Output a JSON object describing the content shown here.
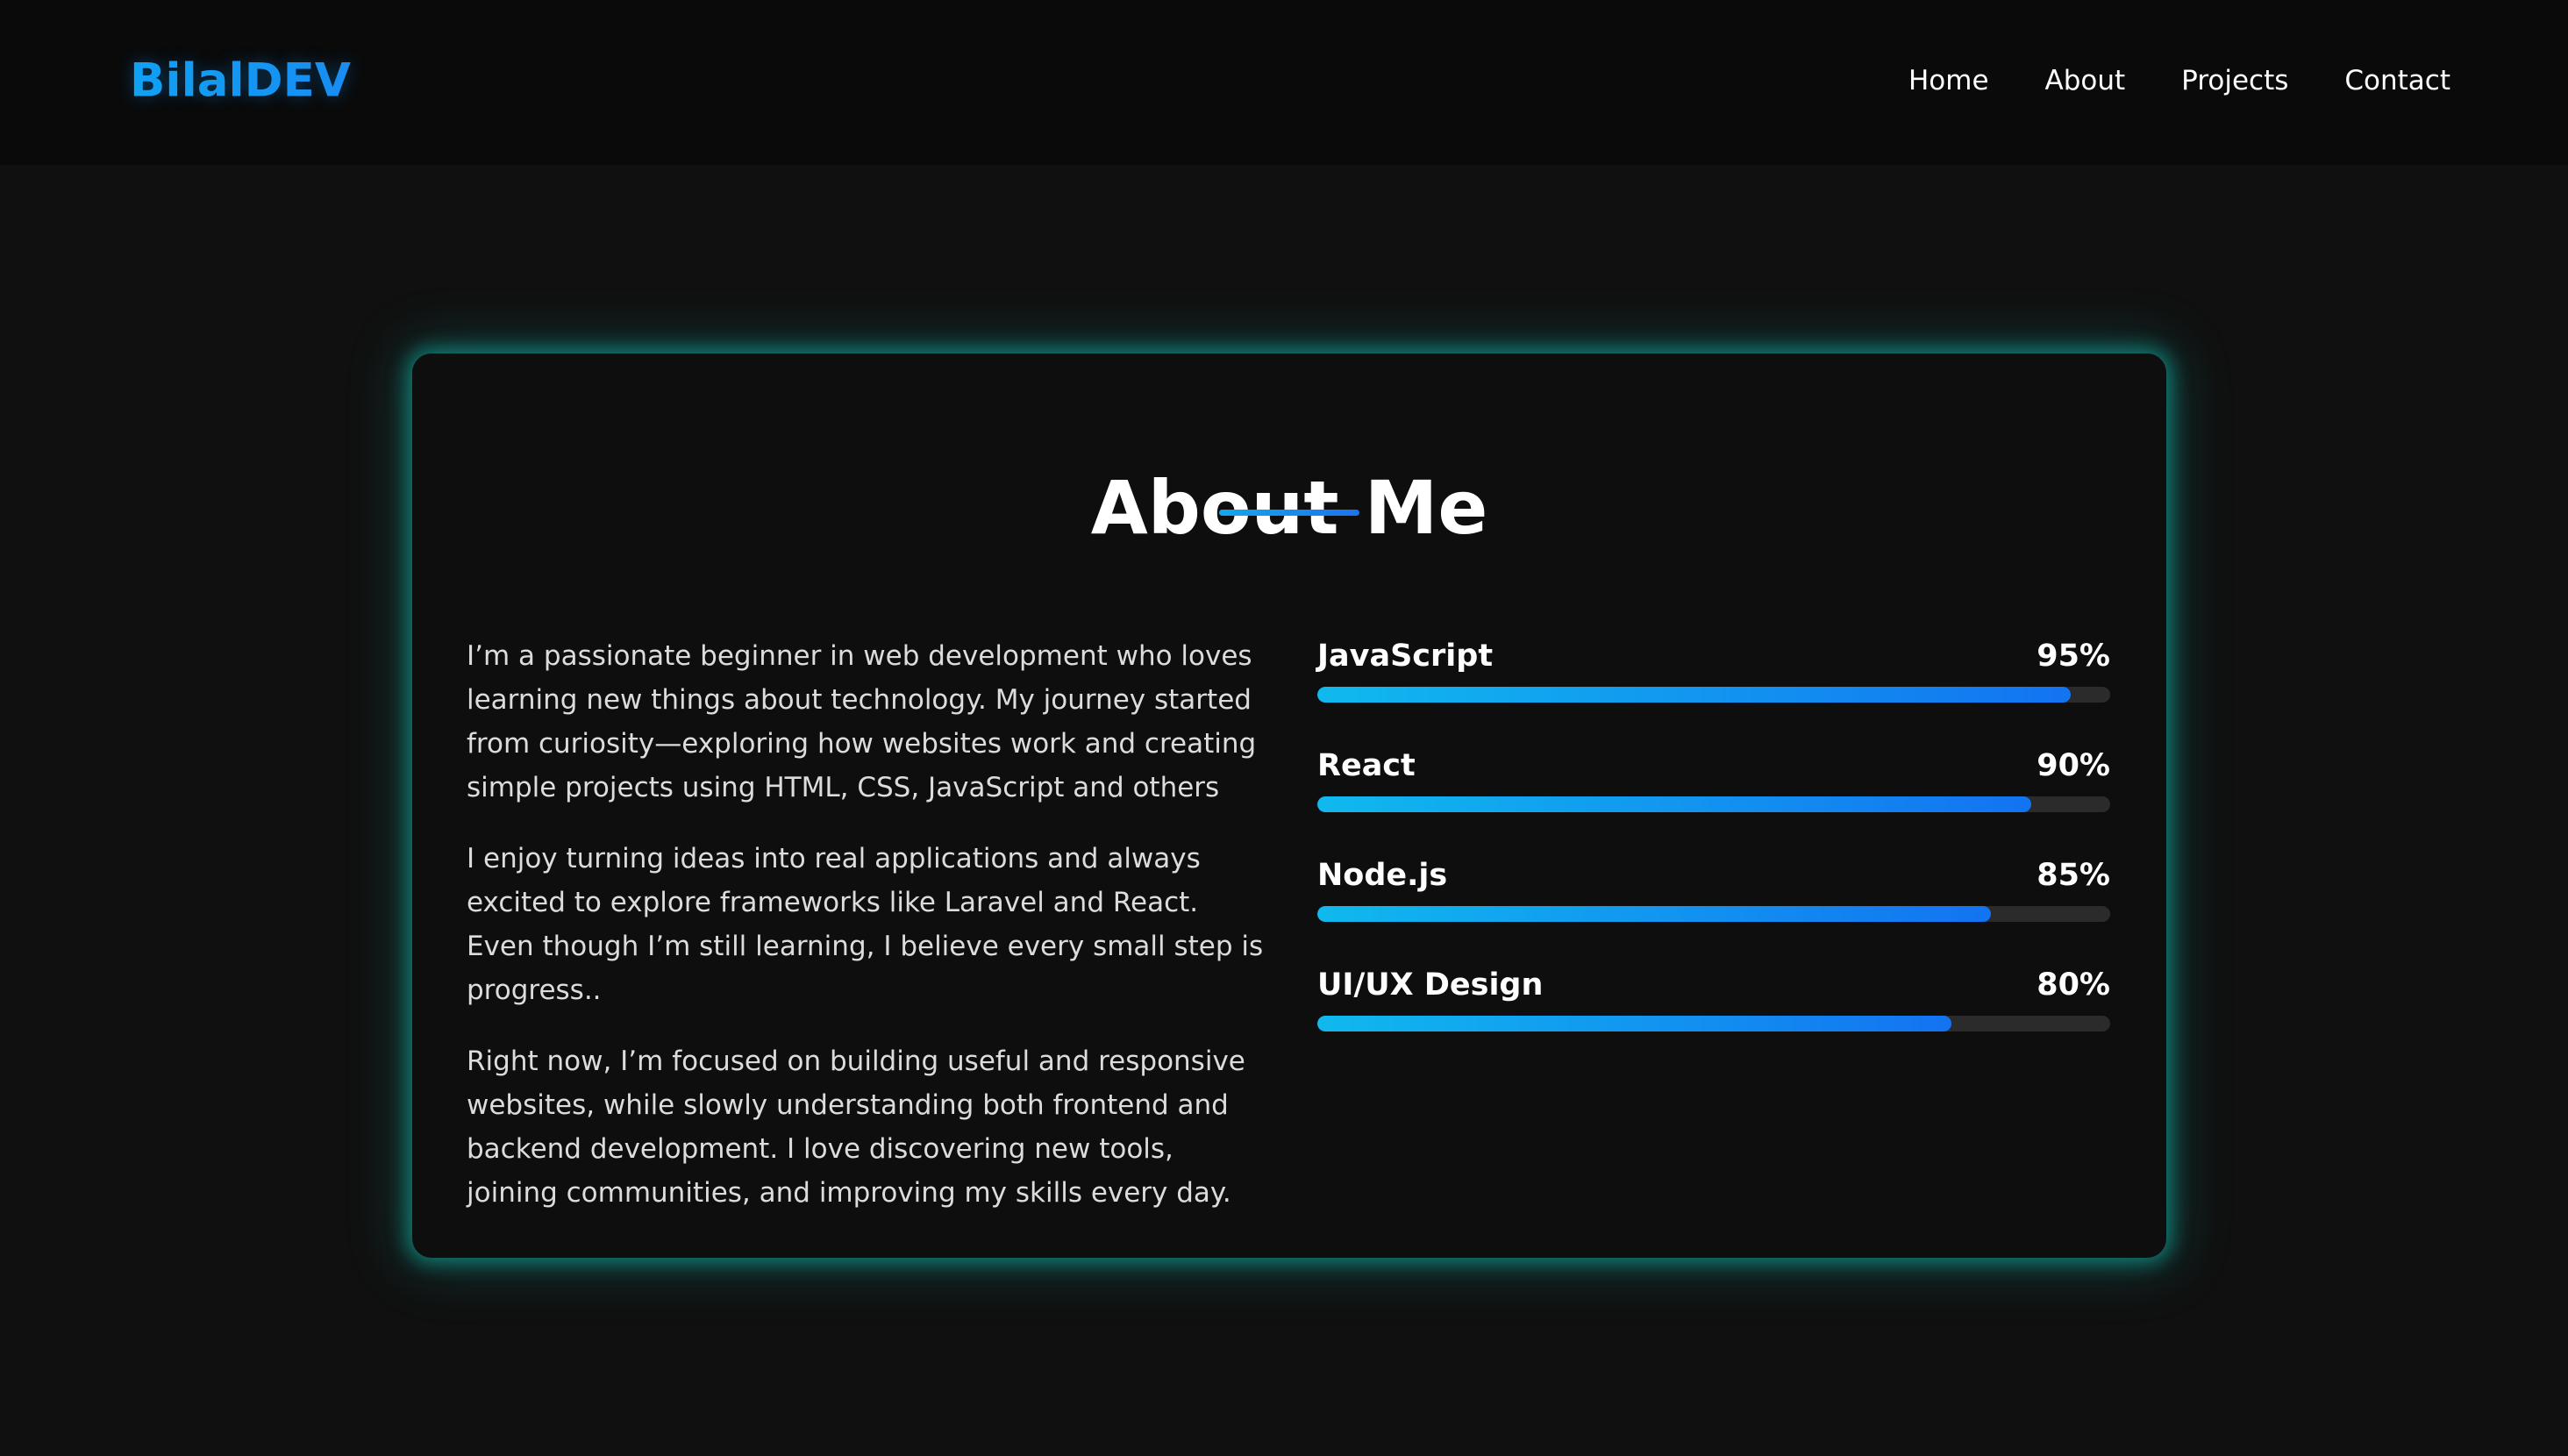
{
  "nav": {
    "brand": "BilalDEV",
    "links": [
      "Home",
      "About",
      "Projects",
      "Contact"
    ]
  },
  "about": {
    "title": "About Me",
    "paragraphs": [
      "I’m a passionate beginner in web development who loves learning new things about technology. My journey started from curiosity—exploring how websites work and creating simple projects using HTML, CSS, JavaScript and others",
      "I enjoy turning ideas into real applications and always excited to explore frameworks like Laravel and React. Even though I’m still learning, I believe every small step is progress..",
      "Right now, I’m focused on building useful and responsive websites, while slowly understanding both frontend and backend development. I love discovering new tools, joining communities, and improving my skills every day."
    ]
  },
  "skills": [
    {
      "name": "JavaScript",
      "percent_label": "95%",
      "level": 95
    },
    {
      "name": "React",
      "percent_label": "90%",
      "level": 90
    },
    {
      "name": "Node.js",
      "percent_label": "85%",
      "level": 85
    },
    {
      "name": "UI/UX Design",
      "percent_label": "80%",
      "level": 80
    }
  ],
  "colors": {
    "background": "#101010",
    "navbar": "#0a0a0a",
    "card": "#0e0e0f",
    "accent_blue": "#1597ef",
    "glow_teal": "#13beb2",
    "bar_track": "#2b2b2b"
  }
}
